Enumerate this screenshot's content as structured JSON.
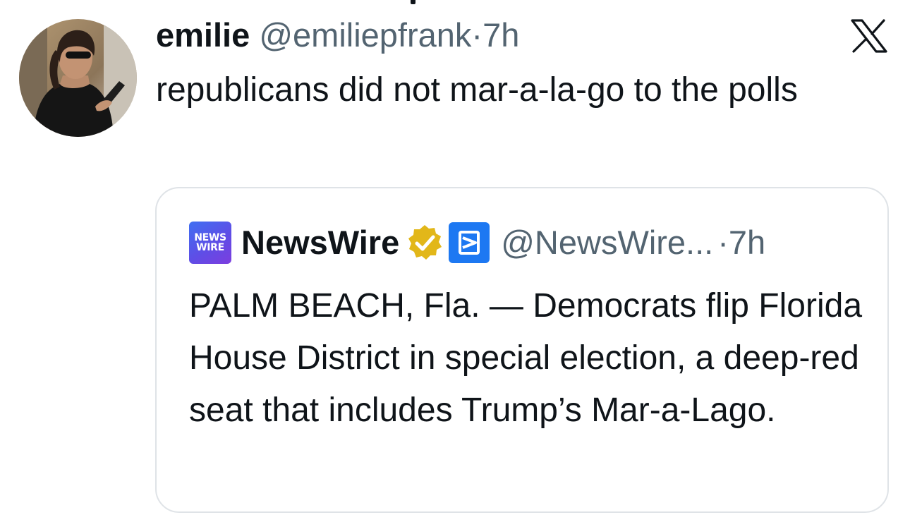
{
  "tweet": {
    "author_name": "emilie",
    "author_handle": "@emiliepfrank",
    "separator": "·",
    "time": "7h",
    "text": "republicans did not mar-a-la-go to the polls",
    "avatar_icon": "profile-photo",
    "platform_icon": "x-logo-icon"
  },
  "quote": {
    "logo_line1": "NEWS",
    "logo_line2": "WIRE",
    "author_name": "NewsWire",
    "author_handle": "@NewsWire...",
    "separator": "·",
    "time": "7h",
    "verified_icon": "verified-badge-icon",
    "affiliate_icon": "affiliate-badge-icon",
    "text": "PALM BEACH, Fla. — Democrats flip Florida House District in special election, a deep-red seat that includes Trump’s Mar-a-Lago."
  },
  "colors": {
    "text": "#0f1419",
    "muted": "#536471",
    "verified_gold": "#e2b719",
    "affiliate_blue": "#1d78f2",
    "card_border": "#dfe3e7"
  }
}
